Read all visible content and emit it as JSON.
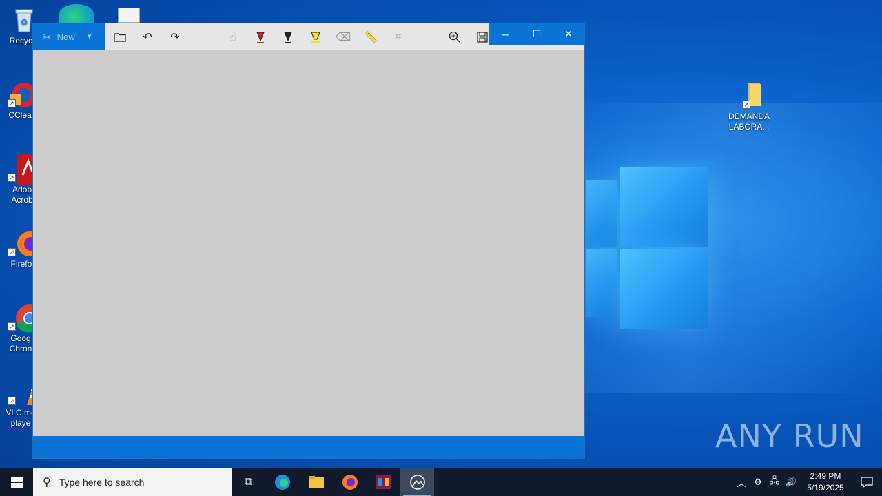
{
  "desktop": {
    "icons": [
      {
        "label": "Recycle",
        "icon": "recycle-bin-icon"
      },
      {
        "label": "CClear",
        "icon": "ccleaner-icon"
      },
      {
        "label": "Adob Acrob",
        "icon": "adobe-acrobat-icon"
      },
      {
        "label": "Firefo",
        "icon": "firefox-icon"
      },
      {
        "label": "Goog Chron",
        "icon": "chrome-icon"
      },
      {
        "label": "VLC me playe",
        "icon": "vlc-icon"
      }
    ],
    "folder": {
      "label_line1": "DEMANDA",
      "label_line2": "LABORA...",
      "icon": "folder-icon"
    },
    "watermark": "ANY RUN"
  },
  "window": {
    "new_label": "New",
    "toolbar_icons": [
      "open-folder-icon",
      "undo-icon",
      "redo-icon",
      "touch-writing-icon",
      "ballpoint-pen-icon",
      "pencil-icon",
      "highlighter-icon",
      "eraser-icon",
      "ruler-icon",
      "crop-icon",
      "zoom-in-icon",
      "save-icon"
    ]
  },
  "taskbar": {
    "search_placeholder": "Type here to search",
    "time": "2:49 PM",
    "date": "5/19/2025"
  },
  "colors": {
    "accent": "#0a74d6",
    "taskbar": "#101a2b",
    "canvas": "#cccccc"
  }
}
